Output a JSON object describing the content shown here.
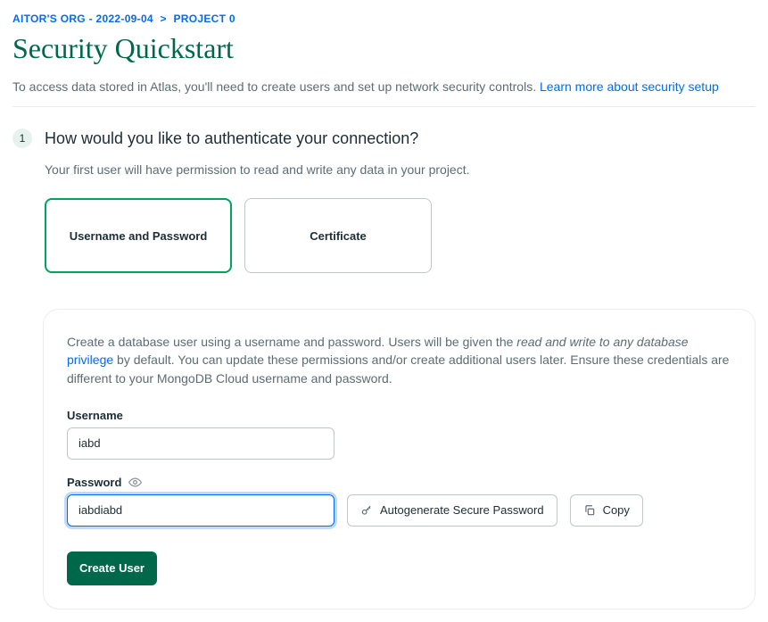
{
  "breadcrumb": {
    "org": "AITOR'S ORG - 2022-09-04",
    "project": "PROJECT 0"
  },
  "page_title": "Security Quickstart",
  "intro_text": "To access data stored in Atlas, you'll need to create users and set up network security controls. ",
  "intro_link": "Learn more about security setup",
  "step1": {
    "number": "1",
    "heading": "How would you like to authenticate your connection?",
    "sub": "Your first user will have permission to read and write any data in your project."
  },
  "methods": {
    "userpass": "Username and Password",
    "cert": "Certificate"
  },
  "panel": {
    "desc_pre": "Create a database user using a username and password. Users will be given the ",
    "desc_em": "read and write to any database",
    "desc_link": " privilege",
    "desc_post": " by default. You can update these permissions and/or create additional users later. Ensure these credentials are different to your MongoDB Cloud username and password.",
    "username_label": "Username",
    "username_value": "iabd",
    "password_label": "Password",
    "password_value": "iabdiabd",
    "autogen_label": "Autogenerate Secure Password",
    "copy_label": "Copy",
    "create_label": "Create User"
  }
}
